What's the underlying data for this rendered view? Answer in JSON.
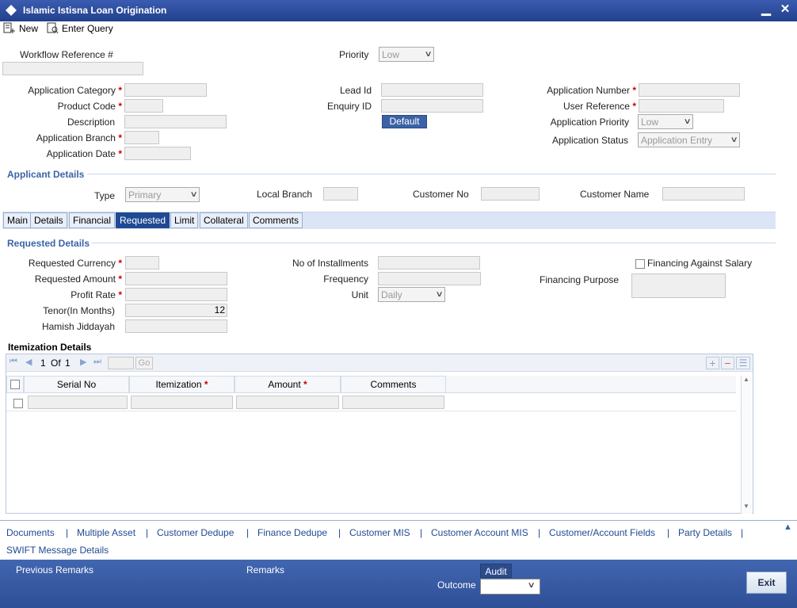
{
  "window": {
    "title": "Islamic Istisna Loan Origination",
    "minimize": "▁",
    "close": "✕"
  },
  "toolbar": {
    "new_label": "New",
    "enter_query_label": "Enter Query"
  },
  "header": {
    "workflow_ref_label": "Workflow Reference #",
    "priority_label": "Priority",
    "priority_value": "Low",
    "application_category_label": "Application Category",
    "product_code_label": "Product Code",
    "description_label": "Description",
    "application_branch_label": "Application Branch",
    "application_date_label": "Application Date",
    "lead_id_label": "Lead Id",
    "enquiry_id_label": "Enquiry ID",
    "default_button": "Default",
    "application_number_label": "Application Number",
    "user_reference_label": "User Reference",
    "application_priority_label": "Application Priority",
    "application_priority_value": "Low",
    "application_status_label": "Application Status",
    "application_status_value": "Application Entry",
    "required_mark": "*"
  },
  "applicant": {
    "section_title": "Applicant Details",
    "type_label": "Type",
    "type_value": "Primary",
    "local_branch_label": "Local Branch",
    "customer_no_label": "Customer No",
    "customer_name_label": "Customer Name"
  },
  "tabs": [
    "Main",
    "Details",
    "Financial",
    "Requested",
    "Limit",
    "Collateral",
    "Comments"
  ],
  "requested": {
    "section_title": "Requested Details",
    "currency_label": "Requested Currency",
    "amount_label": "Requested Amount",
    "profit_rate_label": "Profit Rate",
    "tenor_label": "Tenor(In Months)",
    "tenor_value": "12",
    "hamish_label": "Hamish Jiddayah",
    "installments_label": "No of Installments",
    "frequency_label": "Frequency",
    "unit_label": "Unit",
    "unit_value": "Daily",
    "financing_salary_label": "Financing Against Salary",
    "financing_purpose_label": "Financing Purpose"
  },
  "itemization": {
    "section_title": "Itemization Details",
    "page_current": "1",
    "page_of": "Of",
    "page_total": "1",
    "go_label": "Go",
    "columns": [
      "Serial No",
      "Itemization",
      "Amount",
      "Comments"
    ]
  },
  "footer_links": [
    "Documents",
    "Multiple Asset",
    "Customer Dedupe",
    "Finance Dedupe",
    "Customer MIS",
    "Customer Account MIS",
    "Customer/Account Fields",
    "Party Details",
    "SWIFT Message Details"
  ],
  "separator": "|",
  "bottom": {
    "previous_remarks_label": "Previous Remarks",
    "remarks_label": "Remarks",
    "audit_label": "Audit",
    "outcome_label": "Outcome",
    "exit_label": "Exit"
  }
}
